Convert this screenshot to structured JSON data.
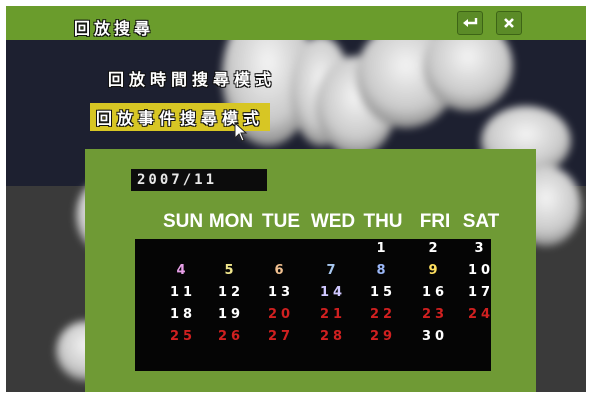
{
  "header": {
    "title": "回放搜尋",
    "enter_icon": "enter-arrow-icon",
    "close_icon": "close-x-icon"
  },
  "menu": {
    "items": [
      {
        "label": "回放時間搜尋模式"
      },
      {
        "label": "回放事件搜尋模式",
        "selected": true
      }
    ]
  },
  "calendar": {
    "month": "2007/11",
    "weekdays": [
      "SUN",
      "MON",
      "TUE",
      "WED",
      "THU",
      "FRI",
      "SAT"
    ],
    "weeks": [
      [
        null,
        null,
        null,
        null,
        "1",
        "2",
        "3"
      ],
      [
        "4",
        "5",
        "6",
        "7",
        "8",
        "9",
        "10"
      ],
      [
        "11",
        "12",
        "13",
        "14",
        "15",
        "16",
        "17"
      ],
      [
        "18",
        "19",
        "20",
        "21",
        "22",
        "23",
        "24"
      ],
      [
        "25",
        "26",
        "27",
        "28",
        "29",
        "30",
        null
      ]
    ],
    "day_colors": {
      "4": "#e8a0e8",
      "5": "#f0e68c",
      "6": "#f0c090",
      "7": "#a8c8f0",
      "8": "#9bb8f8",
      "9": "#ffe060",
      "10": "#ffffff",
      "11": "#ffffff",
      "12": "#ffffff",
      "13": "#ffffff",
      "14": "#d0c8ff",
      "15": "#ffffff",
      "16": "#ffffff",
      "17": "#ffffff",
      "18": "#ffffff",
      "19": "#ffffff",
      "20": "#d02020",
      "21": "#d02020",
      "22": "#d02020",
      "23": "#d02020",
      "24": "#d02020",
      "25": "#d02020",
      "26": "#d02020",
      "27": "#d02020",
      "28": "#d02020",
      "29": "#d02020",
      "30": "#ffffff",
      "1": "#ffffff",
      "2": "#ffffff",
      "3": "#ffffff"
    }
  },
  "colors": {
    "header_bar": "#6a9c2c",
    "selected_highlight": "#d7c624",
    "panel": "#6f9a35",
    "event_day": "#d02020"
  }
}
